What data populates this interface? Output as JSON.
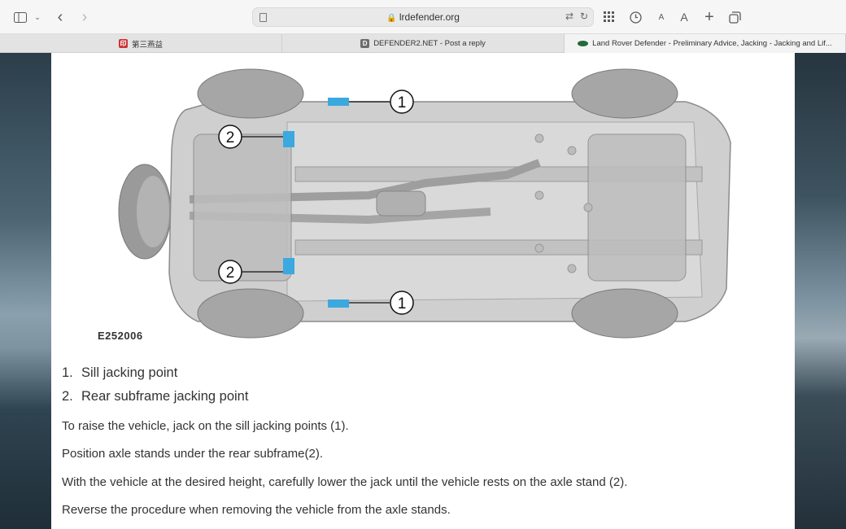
{
  "browser": {
    "url": "lrdefender.org",
    "icons": [
      "sidebar-icon",
      "chevron-down-icon",
      "back-icon",
      "forward-icon",
      "translate-icon",
      "reload-icon",
      "grid-icon",
      "history-icon",
      "text-smaller-icon",
      "text-larger-icon",
      "new-tab-icon",
      "tabs-overview-icon"
    ],
    "text_small": "A",
    "text_large": "A",
    "tabs": [
      {
        "label": "第三燕益",
        "favicon": "red-seal"
      },
      {
        "label": "DEFENDER2.NET - Post a reply",
        "favicon": "D"
      },
      {
        "label": "Land Rover Defender - Preliminary Advice, Jacking - Jacking and Lif...",
        "favicon": "land-rover-oval"
      }
    ]
  },
  "diagram": {
    "callouts": [
      {
        "label": "1"
      },
      {
        "label": "2"
      },
      {
        "label": "2"
      },
      {
        "label": "1"
      }
    ],
    "caption": "E252006"
  },
  "content": {
    "list": [
      {
        "num": "1.",
        "text": "Sill jacking point"
      },
      {
        "num": "2.",
        "text": "Rear subframe jacking point"
      }
    ],
    "paragraphs": [
      "To raise the vehicle, jack on the sill jacking points (1).",
      "Position axle stands under the rear subframe(2).",
      "With the vehicle at the desired height, carefully lower the jack until the vehicle rests on the axle stand (2).",
      "Reverse the procedure when removing the vehicle from the axle stands."
    ]
  },
  "colors": {
    "jack_point": "#3ba9df",
    "body": "#c9c9c9",
    "wheel": "#9a9a9a"
  }
}
